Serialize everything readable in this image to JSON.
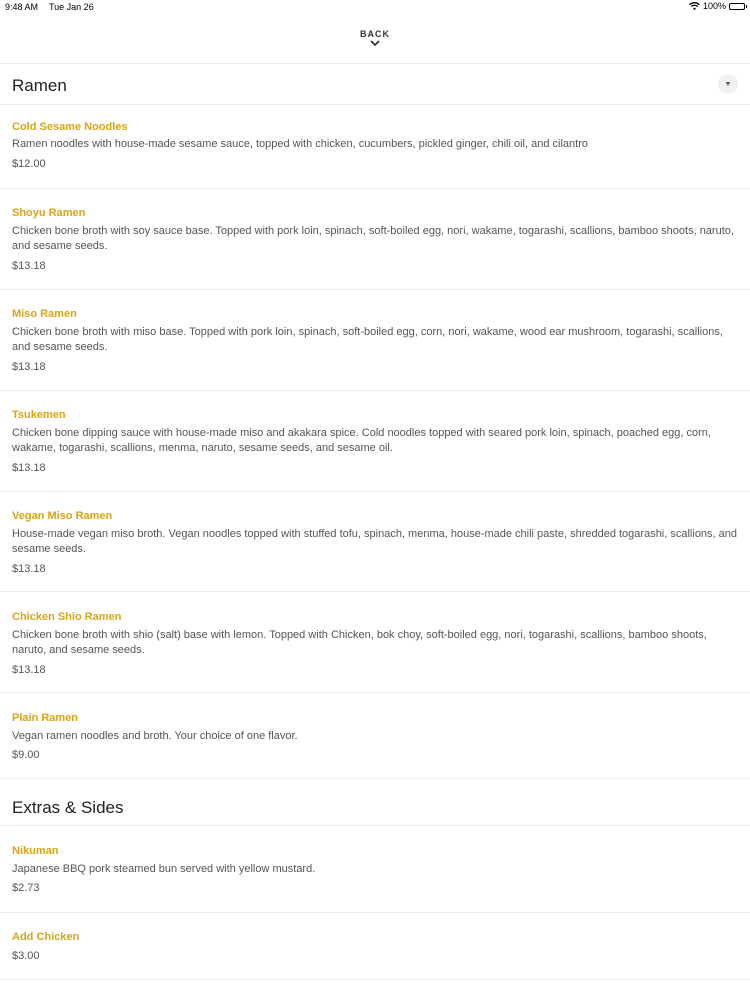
{
  "status": {
    "time": "9:48 AM",
    "date": "Tue Jan 26",
    "battery": "100%"
  },
  "nav": {
    "back_label": "BACK"
  },
  "sections": [
    {
      "title": "Ramen",
      "items": [
        {
          "name": "Cold Sesame Noodles",
          "description": "Ramen noodles with house-made sesame sauce, topped with chicken, cucumbers, pickled ginger, chili oil, and cilantro",
          "price": "$12.00"
        },
        {
          "name": "Shoyu Ramen",
          "description": "Chicken bone broth with soy sauce base. Topped with pork loin, spinach, soft-boiled egg, nori, wakame, togarashi, scallions, bamboo shoots, naruto, and sesame seeds.",
          "price": "$13.18"
        },
        {
          "name": "Miso Ramen",
          "description": "Chicken bone broth with miso base. Topped with pork loin, spinach, soft-boiled egg, corn, nori, wakame, wood ear mushroom, togarashi, scallions, and sesame seeds.",
          "price": "$13.18"
        },
        {
          "name": "Tsukemen",
          "description": "Chicken bone dipping sauce with house-made miso and akakara spice. Cold noodles topped with seared pork loin, spinach, poached egg, corn, wakame, togarashi, scallions, menma, naruto, sesame seeds, and sesame oil.",
          "price": "$13.18"
        },
        {
          "name": "Vegan Miso Ramen",
          "description": "House-made vegan miso broth. Vegan noodles topped with stuffed tofu, spinach, menma, house-made chili paste, shredded togarashi, scallions, and sesame seeds.",
          "price": "$13.18"
        },
        {
          "name": "Chicken Shio Ramen",
          "description": "Chicken bone broth with shio (salt) base with lemon. Topped with Chicken, bok choy, soft-boiled egg, nori, togarashi, scallions, bamboo shoots, naruto, and sesame seeds.",
          "price": "$13.18"
        },
        {
          "name": "Plain Ramen",
          "description": "Vegan ramen noodles and broth. Your choice of one flavor.",
          "price": "$9.00"
        }
      ]
    },
    {
      "title": "Extras & Sides",
      "items": [
        {
          "name": "Nikuman",
          "description": "Japanese BBQ pork steamed bun served with yellow mustard.",
          "price": "$2.73"
        },
        {
          "name": "Add Chicken",
          "description": "",
          "price": "$3.00"
        }
      ]
    }
  ]
}
